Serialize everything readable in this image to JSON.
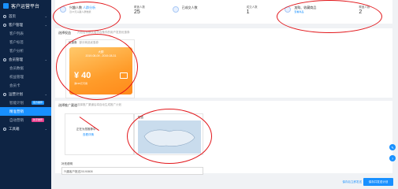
{
  "app": {
    "title": "客户运营平台"
  },
  "sidebar": {
    "items": [
      {
        "label": "首页",
        "type": "main"
      },
      {
        "label": "客户管理",
        "type": "main"
      },
      {
        "label": "客户列表",
        "type": "sub"
      },
      {
        "label": "客户标签",
        "type": "sub"
      },
      {
        "label": "客户分析",
        "type": "sub"
      },
      {
        "label": "会员管理",
        "type": "main"
      },
      {
        "label": "会员数据",
        "type": "sub"
      },
      {
        "label": "权益管理",
        "type": "sub"
      },
      {
        "label": "会员卡",
        "type": "sub"
      },
      {
        "label": "运营计划",
        "type": "main"
      },
      {
        "label": "智能计划",
        "type": "sub",
        "tag": "官方推荐",
        "tag_color": "#1890ff"
      },
      {
        "label": "精准营销",
        "type": "sub",
        "active": true
      },
      {
        "label": "自动营销",
        "type": "sub",
        "tag": "新手推荐",
        "tag_color": "#e83e8c"
      },
      {
        "label": "工具箱",
        "type": "main"
      }
    ]
  },
  "stats": [
    {
      "label": "兴趣人数",
      "link": "人群分析",
      "sub": "近15天兴趣人群数据",
      "val_label": "覆盖人数",
      "value": "25"
    },
    {
      "label": "已成交人数",
      "sub": "",
      "val_label": "成交人数",
      "value": "1"
    },
    {
      "label": "加购、收藏商品",
      "link": "查看商品",
      "sub": "兴趣人群加购收藏",
      "val_label": "覆盖人数",
      "value": "2"
    }
  ],
  "coupon_section": {
    "title": "选择权益",
    "hint": "开启后将默认给符合条件的用户发放优惠券",
    "card_title": "优惠券",
    "card_hint": "部分商品优惠券",
    "card_top": "大额",
    "card_date": "2019-08-09 - 2019-08-31",
    "amount": "¥ 40",
    "condition": "满199元可用"
  },
  "content_section": {
    "title": "选择推广渠道",
    "hint": "选择推广渠道后将自动生成推广计划",
    "card_a_text": "正在为您推荐中",
    "card_a_link": "查看详情",
    "card_b_title": "短信"
  },
  "sms": {
    "label": "补充说明",
    "value": "兴趣客户推送20190808"
  },
  "footer": {
    "ghost": "保存后立即发送",
    "primary": "保存并发送计划"
  }
}
